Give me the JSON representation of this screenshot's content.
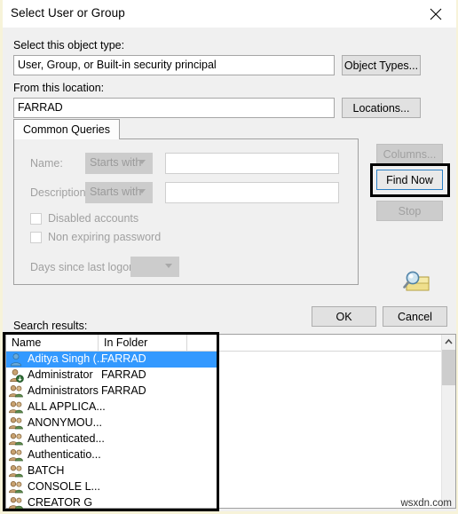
{
  "window": {
    "title": "Select User or Group",
    "close_icon": "close-icon"
  },
  "object_type": {
    "label": "Select this object type:",
    "value": "User, Group, or Built-in security principal",
    "button": "Object Types..."
  },
  "location": {
    "label": "From this location:",
    "value": "FARRAD",
    "button": "Locations..."
  },
  "tab": {
    "label": "Common Queries"
  },
  "queries": {
    "name_label": "Name:",
    "name_operator": "Starts with",
    "name_value": "",
    "description_label": "Description:",
    "description_operator": "Starts with",
    "description_value": "",
    "disabled_accounts_label": "Disabled accounts",
    "non_expiring_label": "Non expiring password",
    "days_label": "Days since last logon:",
    "days_value": ""
  },
  "side_buttons": {
    "columns": "Columns...",
    "find_now": "Find Now",
    "stop": "Stop",
    "search_icon": "magnifier-folder-icon"
  },
  "dialog_buttons": {
    "ok": "OK",
    "cancel": "Cancel"
  },
  "results": {
    "label": "Search results:",
    "columns": [
      "Name",
      "In Folder"
    ],
    "rows": [
      {
        "name": "Aditya Singh (...",
        "folder": "FARRAD",
        "icon": "user-icon",
        "selected": true
      },
      {
        "name": "Administrator",
        "folder": "FARRAD",
        "icon": "user-admin-icon",
        "selected": false
      },
      {
        "name": "Administrators",
        "folder": "FARRAD",
        "icon": "group-icon",
        "selected": false
      },
      {
        "name": "ALL APPLICA...",
        "folder": "",
        "icon": "group-icon",
        "selected": false
      },
      {
        "name": "ANONYMOU...",
        "folder": "",
        "icon": "group-icon",
        "selected": false
      },
      {
        "name": "Authenticated...",
        "folder": "",
        "icon": "group-icon",
        "selected": false
      },
      {
        "name": "Authenticatio...",
        "folder": "",
        "icon": "group-icon",
        "selected": false
      },
      {
        "name": "BATCH",
        "folder": "",
        "icon": "group-icon",
        "selected": false
      },
      {
        "name": "CONSOLE L...",
        "folder": "",
        "icon": "group-icon",
        "selected": false
      },
      {
        "name": "CREATOR G",
        "folder": "",
        "icon": "group-icon",
        "selected": false
      }
    ]
  },
  "watermark": "wsxdn.com",
  "colors": {
    "selection": "#3399ff",
    "focus_border": "#2b7fc4",
    "annotation": "#000000",
    "window_bg": "#f0f0f0",
    "page_bg": "#f7f3d9"
  }
}
